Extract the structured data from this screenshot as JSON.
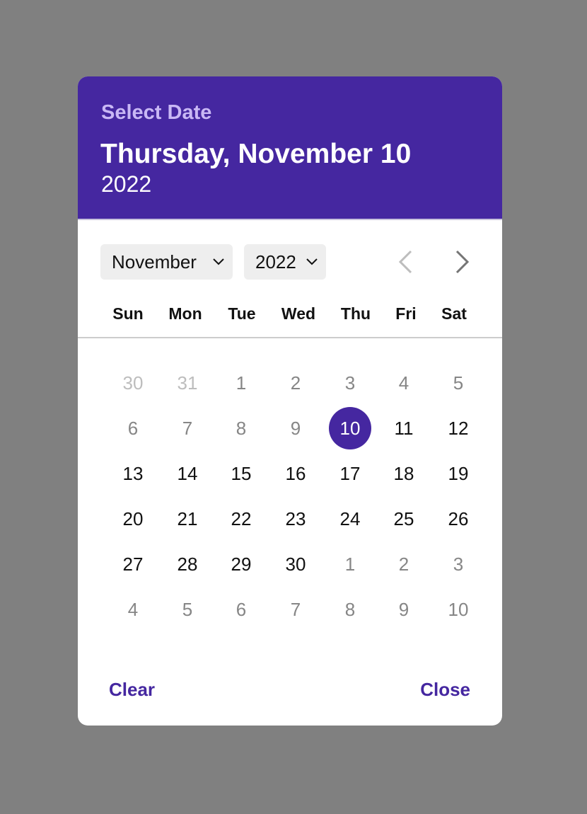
{
  "header": {
    "label": "Select Date",
    "date": "Thursday, November 10",
    "year": "2022"
  },
  "controls": {
    "month": "November",
    "year": "2022",
    "prev_icon": "chevron-left-icon",
    "next_icon": "chevron-right-icon"
  },
  "weekdays": [
    "Sun",
    "Mon",
    "Tue",
    "Wed",
    "Thu",
    "Fri",
    "Sat"
  ],
  "weeks": [
    [
      {
        "label": "30",
        "state": "faded"
      },
      {
        "label": "31",
        "state": "faded"
      },
      {
        "label": "1",
        "state": "muted"
      },
      {
        "label": "2",
        "state": "muted"
      },
      {
        "label": "3",
        "state": "muted"
      },
      {
        "label": "4",
        "state": "muted"
      },
      {
        "label": "5",
        "state": "muted"
      }
    ],
    [
      {
        "label": "6",
        "state": "muted"
      },
      {
        "label": "7",
        "state": "muted"
      },
      {
        "label": "8",
        "state": "muted"
      },
      {
        "label": "9",
        "state": "muted"
      },
      {
        "label": "10",
        "state": "selected"
      },
      {
        "label": "11",
        "state": "normal"
      },
      {
        "label": "12",
        "state": "normal"
      }
    ],
    [
      {
        "label": "13",
        "state": "normal"
      },
      {
        "label": "14",
        "state": "normal"
      },
      {
        "label": "15",
        "state": "normal"
      },
      {
        "label": "16",
        "state": "normal"
      },
      {
        "label": "17",
        "state": "normal"
      },
      {
        "label": "18",
        "state": "normal"
      },
      {
        "label": "19",
        "state": "normal"
      }
    ],
    [
      {
        "label": "20",
        "state": "normal"
      },
      {
        "label": "21",
        "state": "normal"
      },
      {
        "label": "22",
        "state": "normal"
      },
      {
        "label": "23",
        "state": "normal"
      },
      {
        "label": "24",
        "state": "normal"
      },
      {
        "label": "25",
        "state": "normal"
      },
      {
        "label": "26",
        "state": "normal"
      }
    ],
    [
      {
        "label": "27",
        "state": "normal"
      },
      {
        "label": "28",
        "state": "normal"
      },
      {
        "label": "29",
        "state": "normal"
      },
      {
        "label": "30",
        "state": "normal"
      },
      {
        "label": "1",
        "state": "muted"
      },
      {
        "label": "2",
        "state": "muted"
      },
      {
        "label": "3",
        "state": "muted"
      }
    ],
    [
      {
        "label": "4",
        "state": "muted"
      },
      {
        "label": "5",
        "state": "muted"
      },
      {
        "label": "6",
        "state": "muted"
      },
      {
        "label": "7",
        "state": "muted"
      },
      {
        "label": "8",
        "state": "muted"
      },
      {
        "label": "9",
        "state": "muted"
      },
      {
        "label": "10",
        "state": "muted"
      }
    ]
  ],
  "actions": {
    "clear": "Clear",
    "close": "Close"
  },
  "colors": {
    "accent": "#4527a0",
    "backdrop": "#808080",
    "header_label": "#c9b8f5"
  }
}
